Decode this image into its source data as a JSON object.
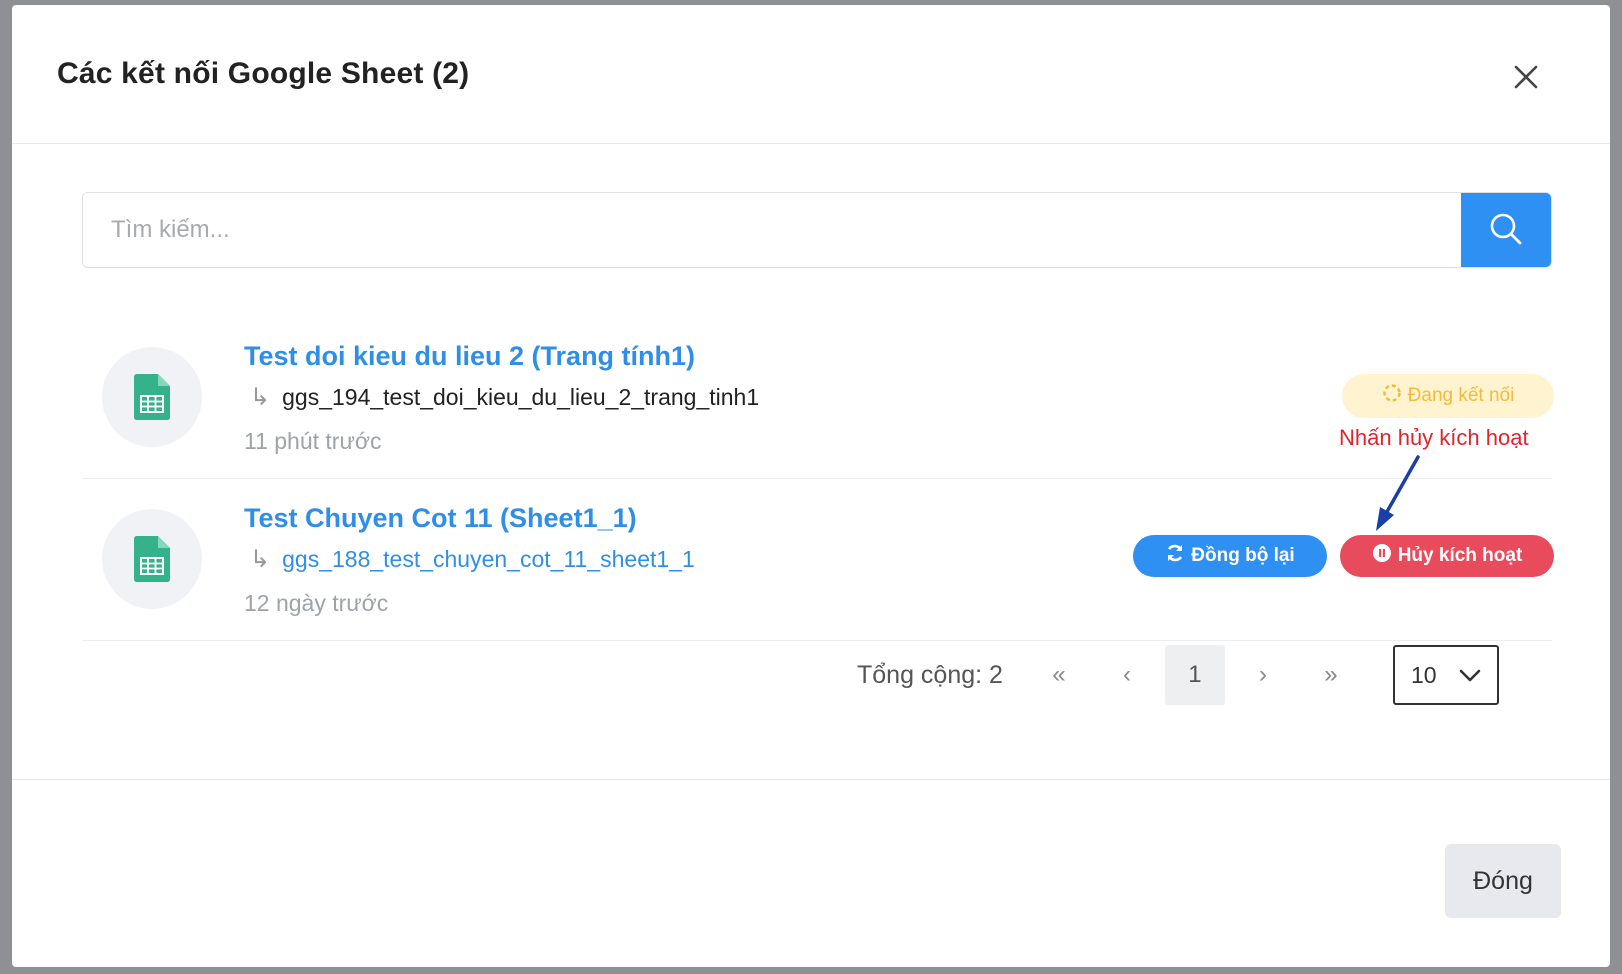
{
  "modal": {
    "title": "Các kết nối Google Sheet (2)",
    "close_icon": "close-icon"
  },
  "search": {
    "placeholder": "Tìm kiếm...",
    "icon": "search-icon"
  },
  "connections": [
    {
      "title": "Test doi kieu du lieu 2 (Trang tính1)",
      "table": "ggs_194_test_doi_kieu_du_lieu_2_trang_tinh1",
      "time": "11 phút trước",
      "status": "Đang kết nối",
      "icon": "spreadsheet-icon"
    },
    {
      "title": "Test Chuyen Cot 11 (Sheet1_1)",
      "table": "ggs_188_test_chuyen_cot_11_sheet1_1",
      "time": "12 ngày trước",
      "sync_label": "Đồng bộ lại",
      "deactivate_label": "Hủy kích hoạt",
      "icon": "spreadsheet-icon"
    }
  ],
  "annotation": {
    "text": "Nhấn hủy kích hoạt",
    "color": "#e0242c",
    "arrow_color": "#1a3fa8"
  },
  "pagination": {
    "total": "Tổng cộng: 2",
    "first": "«",
    "prev": "‹",
    "current_page": "1",
    "next": "›",
    "last": "»",
    "page_size": "10"
  },
  "footer": {
    "close_label": "Đóng"
  },
  "colors": {
    "primary": "#2f90f4",
    "danger": "#e84b5c",
    "warning_bg": "#fff4cf",
    "warning_text": "#f6b93a",
    "sheet_green": "#34b28a"
  }
}
